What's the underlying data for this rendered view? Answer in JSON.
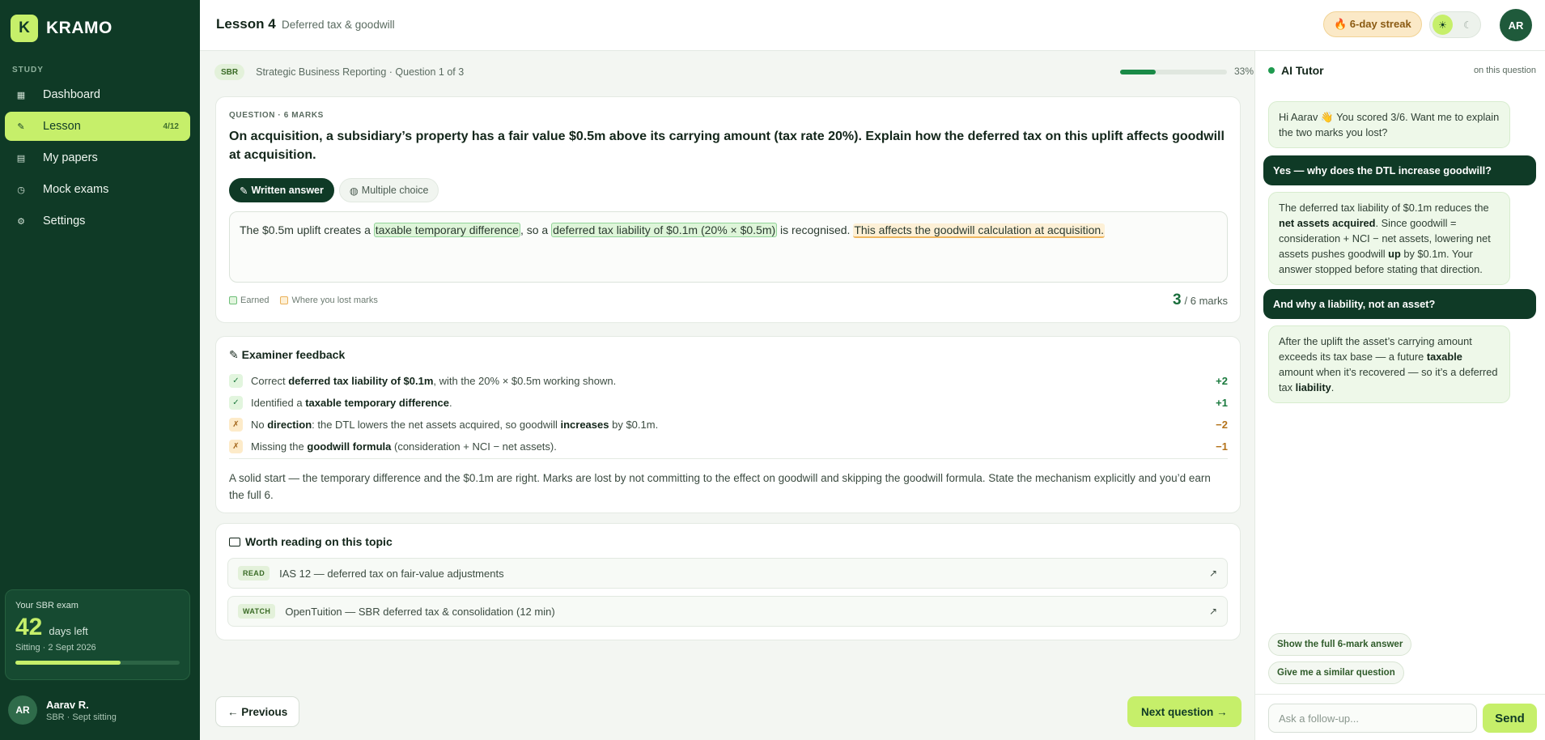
{
  "brand": {
    "logo_letter": "K",
    "name": "KRAMO"
  },
  "sidebar": {
    "section_label": "STUDY",
    "items": [
      {
        "label": "Dashboard",
        "icon": "grid-icon",
        "glyph": "▦",
        "active": false,
        "badge": ""
      },
      {
        "label": "Lesson",
        "icon": "pencil-icon",
        "glyph": "✎",
        "active": true,
        "badge": "4/12"
      },
      {
        "label": "My papers",
        "icon": "papers-icon",
        "glyph": "▤",
        "active": false,
        "badge": ""
      },
      {
        "label": "Mock exams",
        "icon": "clock-icon",
        "glyph": "◷",
        "active": false,
        "badge": ""
      },
      {
        "label": "Settings",
        "icon": "gear-icon",
        "glyph": "⚙",
        "active": false,
        "badge": ""
      }
    ],
    "exam": {
      "label": "Your SBR exam",
      "days": "42",
      "days_unit": "days left",
      "sitting": "Sitting · 2 Sept 2026",
      "progress": 0.64
    },
    "user": {
      "initials": "AR",
      "name": "Aarav R.",
      "sub": "SBR · Sept sitting"
    }
  },
  "header": {
    "title": "Lesson 4",
    "subtitle": "Deferred tax & goodwill",
    "streak": "🔥 6-day streak",
    "theme": {
      "light_glyph": "☀",
      "dark_glyph": "☾",
      "active": "light"
    },
    "avatar": "AR"
  },
  "question_strip": {
    "subject": "SBR",
    "crumb": "Strategic Business Reporting · Question 1 of 3",
    "progress_pct": "33%",
    "progress": 0.33
  },
  "question": {
    "meta": "QUESTION · 6 MARKS",
    "text": "On acquisition, a subsidiary’s property has a fair value $0.5m above its carrying amount (tax rate 20%). Explain how the deferred tax on this uplift affects goodwill at acquisition.",
    "tabs": [
      {
        "label": "Written answer",
        "glyph": "✎",
        "active": true
      },
      {
        "label": "Multiple choice",
        "glyph": "◍",
        "active": false
      }
    ],
    "answer": {
      "part1": "The $0.5m uplift creates a ",
      "good1": "taxable temporary difference",
      "part2": ", so a ",
      "good2": "deferred tax liability of $0.1m (20% × $0.5m)",
      "part3": " is recognised. ",
      "lost1": "This affects the goodwill calculation at acquisition."
    },
    "legend_earned": "Earned",
    "legend_lost": "Where you lost marks",
    "score": "3",
    "score_total": "/ 6 marks"
  },
  "feedback": {
    "title": "✎ Examiner feedback",
    "rows": [
      {
        "status": "ok",
        "glyph": "✓",
        "pre": "Correct ",
        "bold": "deferred tax liability of $0.1m",
        "post": ", with the 20% × $0.5m working shown.",
        "bold2": "",
        "post2": "",
        "delta": "+2"
      },
      {
        "status": "ok",
        "glyph": "✓",
        "pre": "Identified a ",
        "bold": "taxable temporary difference",
        "post": ".",
        "bold2": "",
        "post2": "",
        "delta": "+1"
      },
      {
        "status": "no",
        "glyph": "✗",
        "pre": "No ",
        "bold": "direction",
        "post": ": the DTL lowers the net assets acquired, so goodwill ",
        "bold2": "increases",
        "post2": " by $0.1m.",
        "delta": "−2"
      },
      {
        "status": "no",
        "glyph": "✗",
        "pre": "Missing the ",
        "bold": "goodwill formula",
        "post": " (consideration + NCI − net assets).",
        "bold2": "",
        "post2": "",
        "delta": "−1"
      }
    ],
    "summary": "A solid start — the temporary difference and the $0.1m are right. Marks are lost by not committing to the effect on goodwill and skipping the goodwill formula. State the mechanism explicitly and you’d earn the full 6."
  },
  "reading": {
    "title": "Worth reading on this topic",
    "items": [
      {
        "tag": "READ",
        "text": "IAS 12 — deferred tax on fair-value adjustments",
        "arrow": "↗"
      },
      {
        "tag": "WATCH",
        "text": "OpenTuition — SBR deferred tax & consolidation (12 min)",
        "arrow": "↗"
      }
    ]
  },
  "nav_buttons": {
    "prev": "← Previous",
    "next": "Next question →"
  },
  "tutor": {
    "title": "AI Tutor",
    "context": "on this question",
    "messages": [
      {
        "role": "ai",
        "html": "Hi Aarav 👋 You scored 3/6. Want me to explain the two marks you lost?"
      },
      {
        "role": "user",
        "text": "Yes — why does the DTL increase goodwill?"
      },
      {
        "role": "ai",
        "text": "The deferred tax liability of $0.1m reduces the net assets acquired. Since goodwill = consideration + NCI − net assets, lowering net assets pushes goodwill up by $0.1m. Your answer stopped before stating that direction."
      },
      {
        "role": "user",
        "text": "And why a liability, not an asset?"
      },
      {
        "role": "ai",
        "text": "After the uplift the asset’s carrying amount exceeds its tax base — a future taxable amount when it’s recovered — so it’s a deferred tax liability."
      }
    ],
    "msg3_parts": {
      "a": "The deferred tax liability of $0.1m reduces the ",
      "b": "net assets acquired",
      "c": ". Since goodwill = consideration + NCI − net assets, lowering net assets pushes goodwill ",
      "d": "up",
      "e": " by $0.1m. Your answer stopped before stating that direction."
    },
    "msg5_parts": {
      "a": "After the uplift the asset’s carrying amount exceeds its tax base — a future ",
      "b": "taxable",
      "c": " amount when it’s recovered — so it’s a deferred tax ",
      "d": "liability",
      "e": "."
    },
    "suggestions": [
      "Show the full 6-mark answer",
      "Give me a similar question"
    ],
    "input_placeholder": "Ask a follow-up...",
    "send_label": "Send"
  },
  "colors": {
    "sidebar": "#0f3a26",
    "accent": "#c6ef6a",
    "earned": "#93d49a",
    "lost": "#f0b760"
  }
}
